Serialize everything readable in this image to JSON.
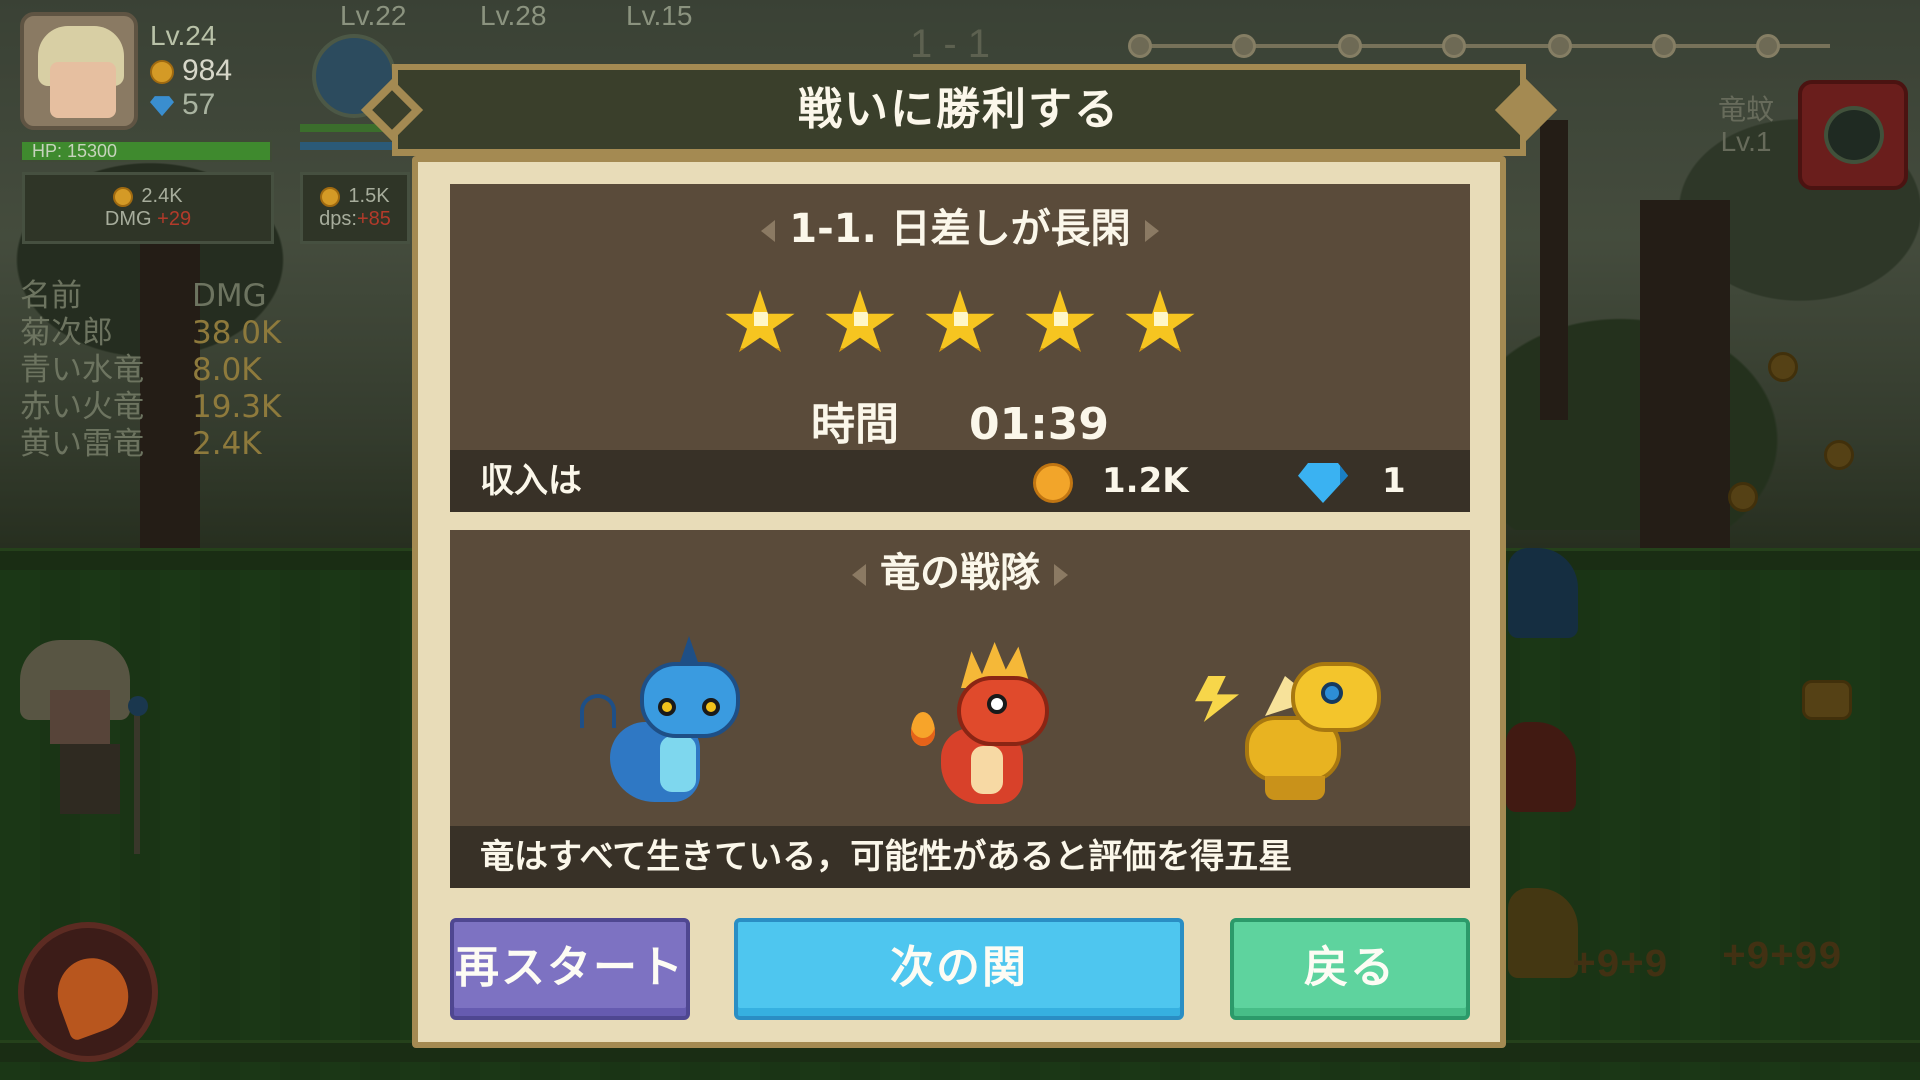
{
  "hud": {
    "level": "Lv.24",
    "coins": "984",
    "gems": "57",
    "hp": "HP: 15300",
    "dmg_box": {
      "value": "2.4K",
      "label": "DMG",
      "bonus": "+29"
    },
    "dps_box": {
      "value": "1.5K",
      "label": "dps:",
      "bonus": "+85"
    },
    "companions": [
      "Lv.22",
      "Lv.28",
      "Lv.15"
    ]
  },
  "damage_table": {
    "header": {
      "name": "名前",
      "value": "DMG"
    },
    "rows": [
      {
        "name": "菊次郎",
        "value": "38.0K"
      },
      {
        "name": "青い水竜",
        "value": "8.0K"
      },
      {
        "name": "赤い火竜",
        "value": "19.3K"
      },
      {
        "name": "黄い雷竜",
        "value": "2.4K"
      }
    ]
  },
  "stage_progress": {
    "label": "1 - 1"
  },
  "enemy": {
    "name": "竜蚊",
    "level": "Lv.1"
  },
  "floating_numbers": [
    "+9+9",
    "+9+99"
  ],
  "dialog": {
    "title": "戦いに勝利する",
    "stage_name": "1-1. 日差しが長閑",
    "stars_earned": 5,
    "stars_total": 5,
    "time_label": "時間",
    "time_value": "01:39",
    "income_label": "収入は",
    "income_coins": "1.2K",
    "income_gems": "1",
    "team_title": "竜の戦隊",
    "team_note": "竜はすべて生きている，可能性があると評価を得五星",
    "buttons": {
      "restart": "再スタート",
      "next": "次の関",
      "back": "戻る"
    }
  },
  "colors": {
    "panel_brown": "#5a4b3a",
    "frame_cream": "#e8dcb8",
    "restart_purple": "#7d72c2",
    "next_blue": "#4ec6ef",
    "back_green": "#5ed39e",
    "star_gold": "#f6c520"
  },
  "icons": [
    "coin-icon",
    "gem-icon",
    "star-icon",
    "fire-skill-icon",
    "arrow-left-icon",
    "arrow-right-icon"
  ]
}
